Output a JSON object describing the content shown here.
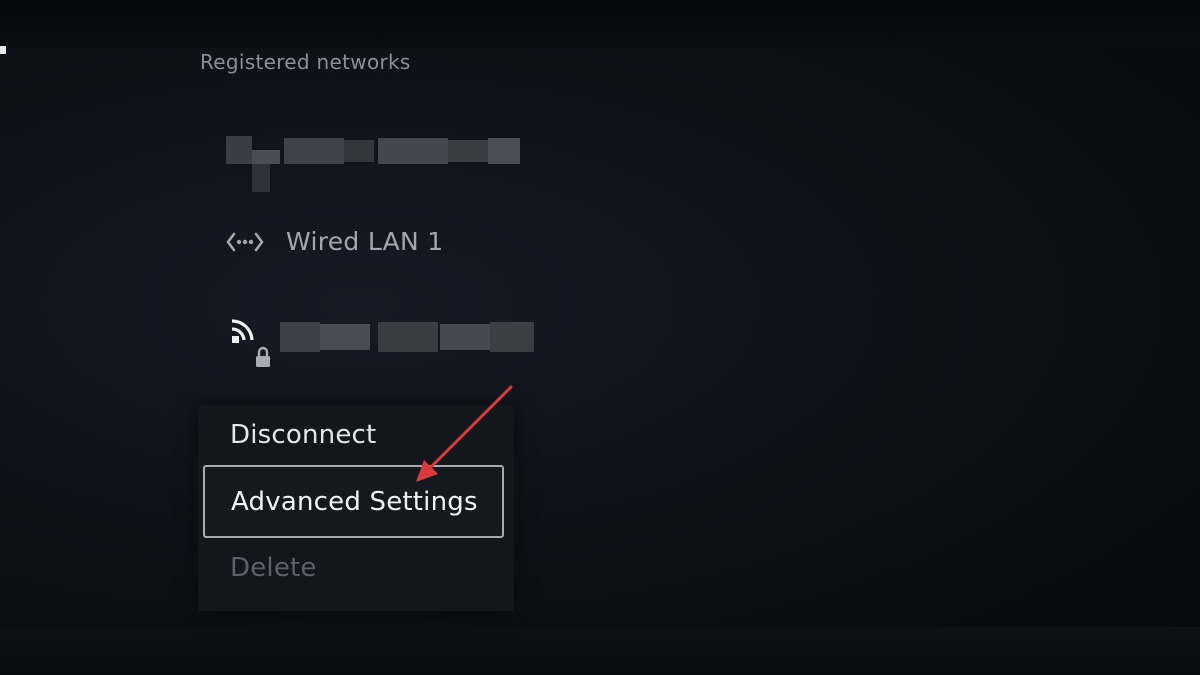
{
  "section": {
    "title": "Registered networks"
  },
  "networks": [
    {
      "type": "wifi",
      "name_masked": true,
      "icon": "wifi-icon"
    },
    {
      "type": "wired",
      "name": "Wired LAN 1",
      "icon": "wired-lan-icon"
    },
    {
      "type": "wifi-secured",
      "name_masked": true,
      "icon": "wifi-lock-icon"
    }
  ],
  "context_menu": {
    "items": [
      {
        "label": "Disconnect",
        "state": "normal"
      },
      {
        "label": "Advanced Settings",
        "state": "focused"
      },
      {
        "label": "Delete",
        "state": "disabled"
      }
    ]
  },
  "annotation": {
    "arrow_color": "#d93a3a",
    "points_to": "Advanced Settings"
  },
  "colors": {
    "background": "#0a0c12",
    "text_primary": "#e6e7ea",
    "text_secondary": "#a3a6ae",
    "text_disabled": "#5d6068",
    "focus_border": "#a7aab1"
  }
}
